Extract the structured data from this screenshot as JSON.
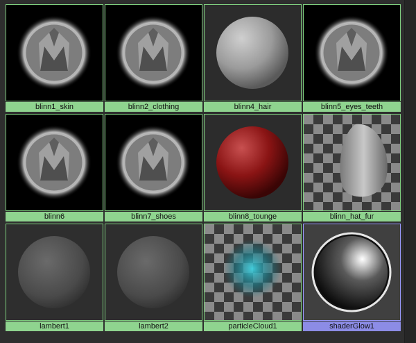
{
  "materials": [
    {
      "name": "blinn1_skin",
      "preview": "default-shader-icon",
      "selected": false
    },
    {
      "name": "blinn2_clothing",
      "preview": "default-shader-icon",
      "selected": false
    },
    {
      "name": "blinn4_hair",
      "preview": "gray-sphere",
      "selected": false
    },
    {
      "name": "blinn5_eyes_teeth",
      "preview": "default-shader-icon",
      "selected": false
    },
    {
      "name": "blinn6",
      "preview": "default-shader-icon",
      "selected": false
    },
    {
      "name": "blinn7_shoes",
      "preview": "default-shader-icon",
      "selected": false
    },
    {
      "name": "blinn8_tounge",
      "preview": "red-sphere",
      "selected": false
    },
    {
      "name": "blinn_hat_fur",
      "preview": "fur-checker",
      "selected": false
    },
    {
      "name": "lambert1",
      "preview": "lambert-sphere",
      "selected": false
    },
    {
      "name": "lambert2",
      "preview": "lambert-sphere",
      "selected": false
    },
    {
      "name": "particleCloud1",
      "preview": "particle-cloud-checker",
      "selected": false
    },
    {
      "name": "shaderGlow1",
      "preview": "glow-sphere",
      "selected": true
    }
  ],
  "colors": {
    "label_green": "#8fd48f",
    "label_selected": "#8c8ce6",
    "border_green": "#7fcf7f",
    "border_selected": "#9a9aff"
  }
}
